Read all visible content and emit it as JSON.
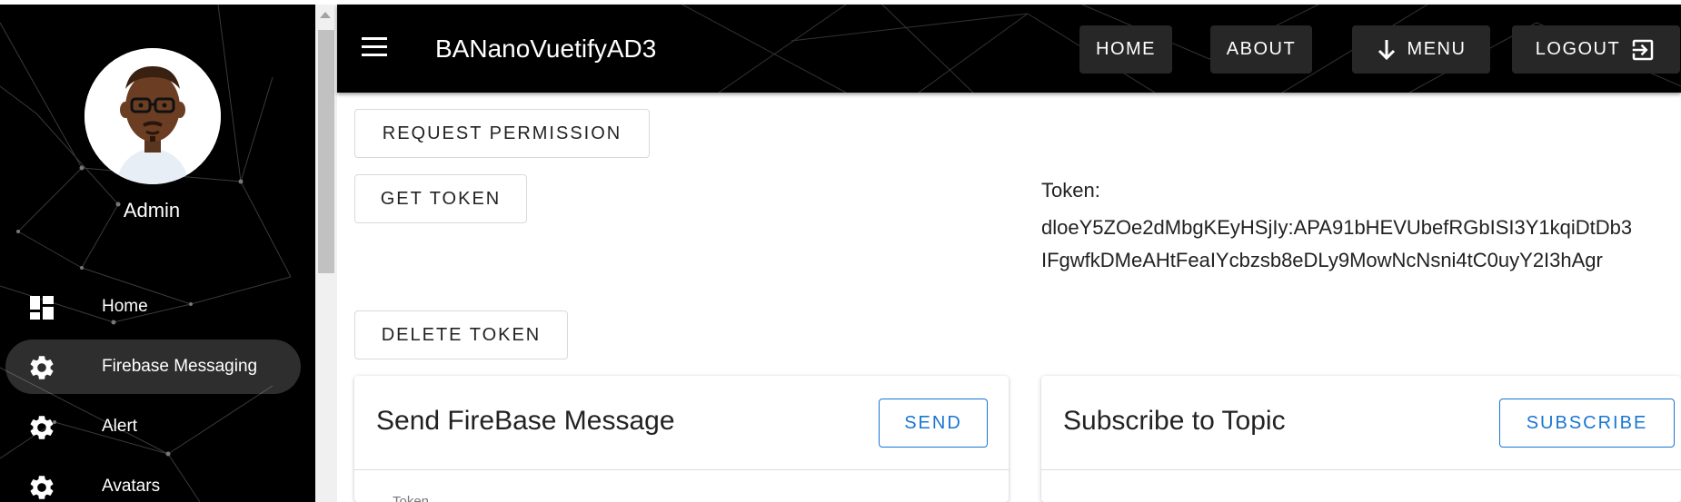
{
  "sidebar": {
    "user_name": "Admin",
    "items": [
      {
        "label": "Home",
        "icon": "dashboard-icon",
        "active": false
      },
      {
        "label": "Firebase Messaging",
        "icon": "gear-icon",
        "active": true
      },
      {
        "label": "Alert",
        "icon": "gear-icon",
        "active": false
      },
      {
        "label": "Avatars",
        "icon": "gear-icon",
        "active": false
      }
    ]
  },
  "appbar": {
    "title": "BANanoVuetifyAD3",
    "buttons": {
      "home": "HOME",
      "about": "ABOUT",
      "menu": "MENU",
      "logout": "LOGOUT"
    }
  },
  "actions": {
    "request_permission": "REQUEST PERMISSION",
    "get_token": "GET TOKEN",
    "delete_token": "DELETE TOKEN"
  },
  "token": {
    "label": "Token:",
    "line1": "dloeY5ZOe2dMbgKEyHSjIy:APA91bHEVUbefRGbISI3Y1kqiDtDb3",
    "line2": "IFgwfkDMeAHtFeaIYcbzsb8eDLy9MowNcNsni4tC0uyY2I3hAgr"
  },
  "cards": {
    "send": {
      "title": "Send FireBase Message",
      "button": "SEND",
      "field_label": "Token"
    },
    "subscribe": {
      "title": "Subscribe to Topic",
      "button": "SUBSCRIBE"
    }
  },
  "colors": {
    "accent": "#1976d2",
    "appbar_bg": "#000000",
    "button_bg": "#272727"
  }
}
